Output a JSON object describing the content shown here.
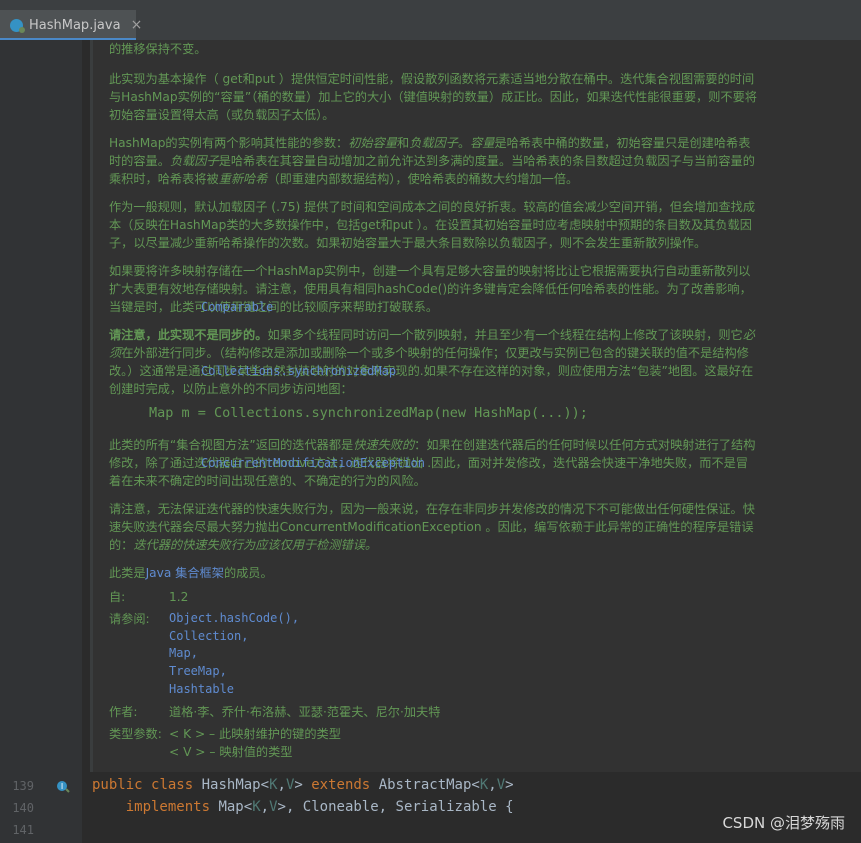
{
  "tab": {
    "title": "HashMap.java",
    "close": "×"
  },
  "doc": {
    "p0": "的推移保持不变。",
    "p1": "此实现为基本操作（ get和put ）提供恒定时间性能，假设散列函数将元素适当地分散在桶中。迭代集合视图需要的时间与HashMap实例的“容量”（桶的数量）加上它的大小（键值映射的数量）成正比。因此，如果迭代性能很重要，则不要将初始容量设置得太高（或负载因子太低）。",
    "p2a": "HashMap的实例有两个影响其性能的参数：",
    "p2b": "初始容量",
    "p2c": "和",
    "p2d": "负载因子",
    "p2e": "。",
    "p2f": "容量",
    "p2g": "是哈希表中桶的数量，初始容量只是创建哈希表时的容量。",
    "p2h": "负载因子",
    "p2i": "是哈希表在其容量自动增加之前允许达到多满的度量。当哈希表的条目数超过负载因子与当前容量的乘积时，哈希表将被",
    "p2j": "重新哈希",
    "p2k": "（即重建内部数据结构），使哈希表的桶数大约增加一倍。",
    "p3": "作为一般规则，默认加载因子 (.75) 提供了时间和空间成本之间的良好折衷。较高的值会减少空间开销，但会增加查找成本（反映在HashMap类的大多数操作中，包括get和put ）。在设置其初始容量时应考虑映射中预期的条目数及其负载因子，以尽量减少重新哈希操作的次数。如果初始容量大于最大条目数除以负载因子，则不会发生重新散列操作。",
    "p4a": "如果要将许多映射存储在一个HashMap实例中，创建一个具有足够大容量的映射将比让它根据需要执行自动重新散列以扩大表更有效地存储映射。请注意，使用具有相同hashCode()的许多键肯定会降低任何哈希表的性能。为了改善影响，当键是",
    "p4b": "Comparable",
    "p4c": "时，此类可以使用键之间的比较顺序来帮助打破联系。",
    "p5a": "请注意，此实现不是同步的。",
    "p5b": "如果多个线程同时访问一个散列映射，并且至少有一个线程在结构上修改了该映射，则它",
    "p5c": "必须",
    "p5d": "在外部进行同步。（结构修改是添加或删除一个或多个映射的任何操作；仅更改与实例已包含的键关联的值不是结构修改。）这通常是通过同步某些自然封装映射的对象来实现的.如果不存在这样的对象，则应使用",
    "p5e": "Collections.synchronizedMap",
    "p5f": "方法“包装”地图。这最好在创建时完成，以防止意外的不同步访问地图：",
    "codeline": "Map m = Collections.synchronizedMap(new HashMap(...));",
    "p6a": "此类的所有“集合视图方法”返回的迭代器都是",
    "p6b": "快速失败的",
    "p6c": "：如果在创建迭代器后的任何时候以任何方式对映射进行了结构修改，除了通过迭代器自己的remove方法，迭代器将抛出",
    "p6d": "ConcurrentModificationException",
    "p6e": " .因此，面对并发修改，迭代器会快速干净地失败，而不是冒着在未来不确定的时间出现任意的、不确定的行为的风险。",
    "p7a": "请注意，无法保证迭代器的快速失败行为，因为一般来说，在存在非同步并发修改的情况下不可能做出任何硬性保证。快速失败迭代器会尽最大努力抛出ConcurrentModificationException 。因此，编写依赖于此异常的正确性的程序是错误的：",
    "p7b": "迭代器的快速失败行为应该仅用于检测错误。",
    "p8a": "此类是",
    "p8b": "Java 集合框架",
    "p8c": "的成员。",
    "since_label": "自:",
    "since_value": "1.2",
    "see_label": "请参阅:",
    "see_items": [
      "Object.hashCode()",
      "Collection",
      "Map",
      "TreeMap",
      "Hashtable"
    ],
    "see_sep": ",",
    "author_label": "作者:",
    "author_value": "道格·李、乔什·布洛赫、亚瑟·范霍夫、尼尔·加夫特",
    "typeparam_label": "类型参数:",
    "typeparam_k": "< K > – 此映射维护的键的类型",
    "typeparam_v": "< V > – 映射值的类型"
  },
  "lines": {
    "n139": "139",
    "n140": "140",
    "n141": "141"
  },
  "code": {
    "public": "public",
    "class": "class",
    "name": "HashMap",
    "k": "K",
    "v": "V",
    "extends": "extends",
    "abs": "AbstractMap",
    "implements": "implements",
    "map": "Map",
    "rest": ", Cloneable, Serializable {"
  },
  "watermark": "CSDN @泪梦殇雨",
  "colors": {
    "doc_text": "#629755",
    "link": "#5f8bd0",
    "keyword": "#cc7832"
  }
}
